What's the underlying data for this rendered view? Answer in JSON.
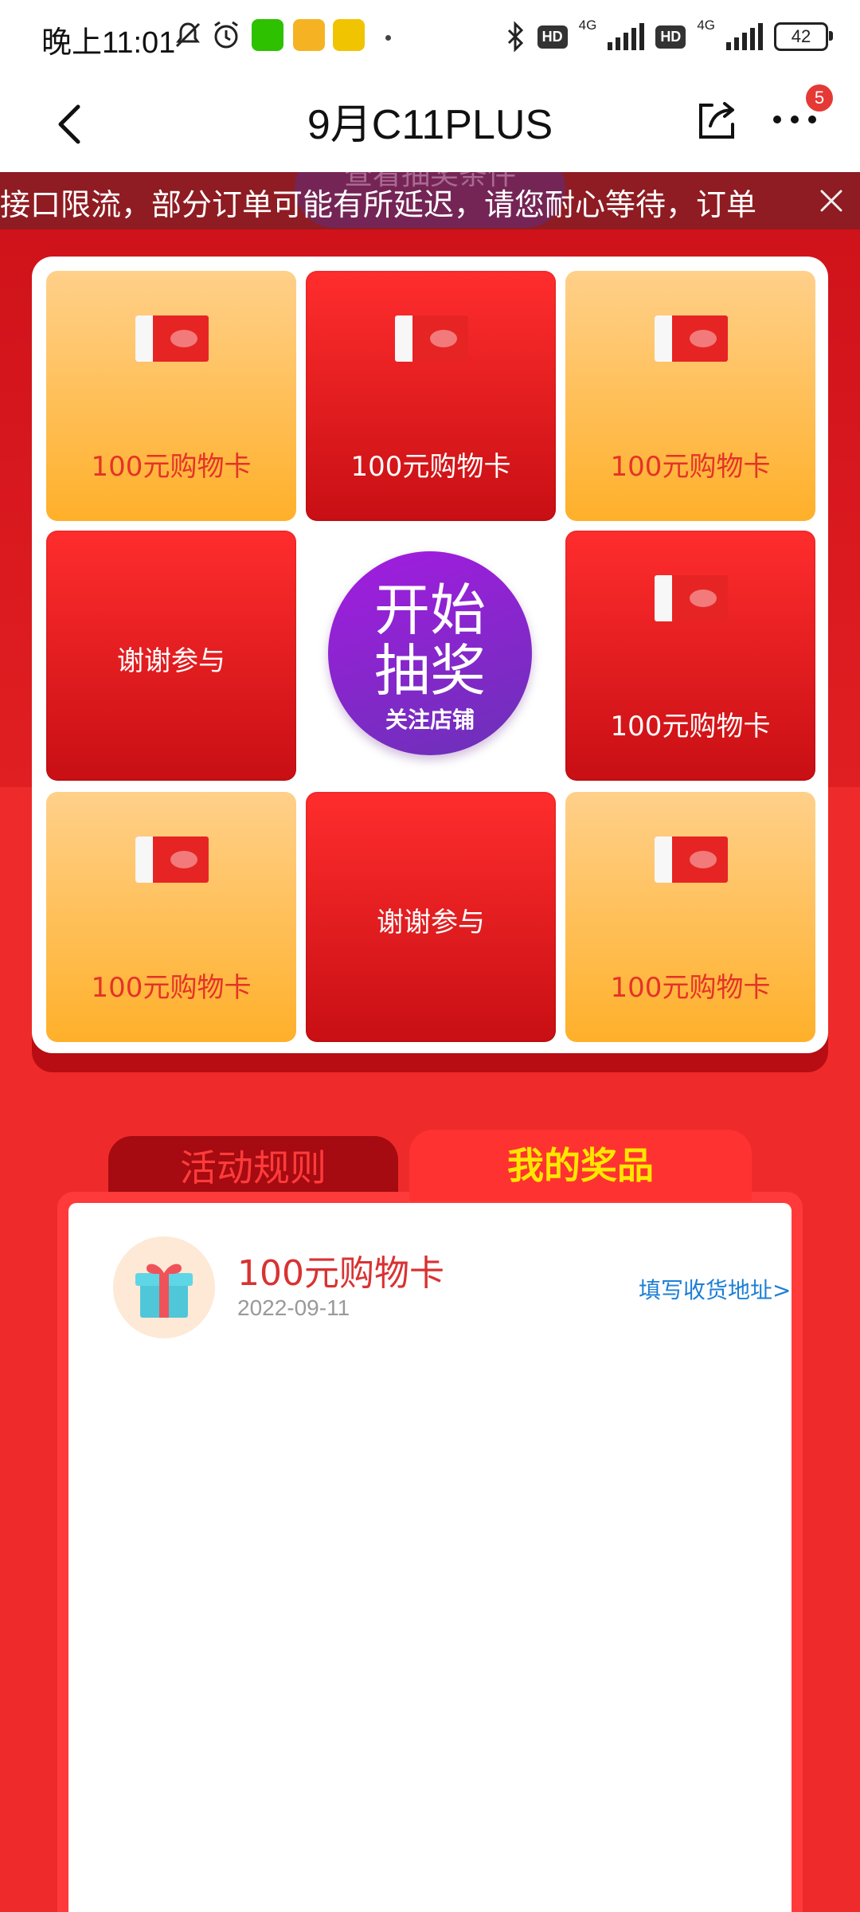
{
  "status_bar": {
    "time": "晚上11:01",
    "hd1": "HD",
    "net1": "4G",
    "hd2": "HD",
    "net2": "4G",
    "battery": "42"
  },
  "nav": {
    "title": "9月C11PLUS",
    "more_badge": "5"
  },
  "notice": {
    "deco_text": "查看抽奖条件",
    "text": "接口限流，部分订单可能有所延迟，请您耐心等待，订单"
  },
  "lottery": {
    "cells": [
      {
        "label": "100元购物卡"
      },
      {
        "label": "100元购物卡"
      },
      {
        "label": "100元购物卡"
      },
      {
        "label": "谢谢参与"
      },
      {
        "label": "100元购物卡"
      },
      {
        "label": "100元购物卡"
      },
      {
        "label": "谢谢参与"
      },
      {
        "label": "100元购物卡"
      }
    ],
    "start_line1": "开始",
    "start_line2": "抽奖",
    "start_sub": "关注店铺"
  },
  "tabs": {
    "rules": "活动规则",
    "prizes": "我的奖品"
  },
  "prizes": [
    {
      "name": "100元购物卡",
      "date": "2022-09-11",
      "action": "填写收货地址>"
    }
  ]
}
